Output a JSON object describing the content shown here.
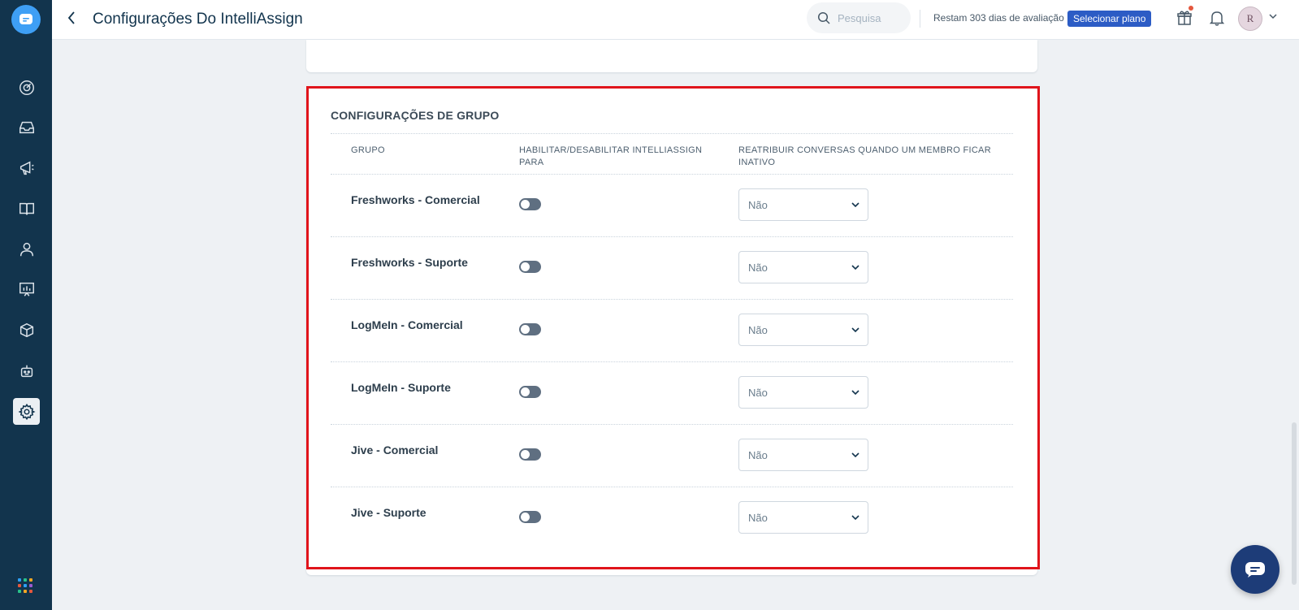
{
  "header": {
    "title": "Configurações Do IntelliAssign",
    "search_placeholder": "Pesquisa",
    "trial_text": "Restam 303 dias de avaliação",
    "plan_button": "Selecionar plano",
    "avatar_initial": "R"
  },
  "sidebar": {
    "items": [
      "dashboard-icon",
      "inbox-icon",
      "campaigns-icon",
      "knowledge-base-icon",
      "contacts-icon",
      "reports-icon",
      "integrations-icon",
      "bots-icon",
      "settings-icon"
    ],
    "active": "settings-icon"
  },
  "group_settings": {
    "title": "CONFIGURAÇÕES DE GRUPO",
    "columns": {
      "group": "GRUPO",
      "enable": "HABILITAR/DESABILITAR INTELLIASSIGN PARA",
      "reassign": "REATRIBUIR CONVERSAS QUANDO UM MEMBRO FICAR INATIVO"
    },
    "rows": [
      {
        "name": "Freshworks - Comercial",
        "enabled": false,
        "reassign": "Não"
      },
      {
        "name": "Freshworks - Suporte",
        "enabled": false,
        "reassign": "Não"
      },
      {
        "name": "LogMeIn - Comercial",
        "enabled": false,
        "reassign": "Não"
      },
      {
        "name": "LogMeIn - Suporte",
        "enabled": false,
        "reassign": "Não"
      },
      {
        "name": "Jive - Comercial",
        "enabled": false,
        "reassign": "Não"
      },
      {
        "name": "Jive - Suporte",
        "enabled": false,
        "reassign": "Não"
      }
    ]
  },
  "colors": {
    "sidebar_bg": "#12344d",
    "primary_button": "#2c5cc5",
    "highlight_border": "#e0141b",
    "toggle_off": "#5f6f81",
    "chat_fab": "#1d3c78"
  }
}
